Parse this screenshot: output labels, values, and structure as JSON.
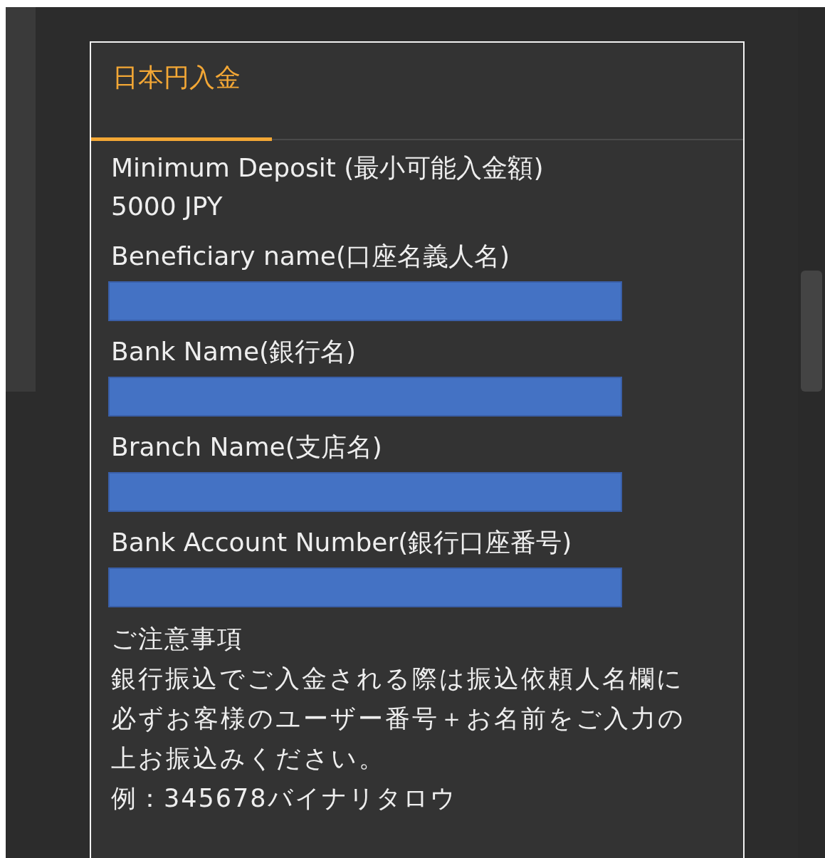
{
  "tabs": [
    {
      "label": "日本円入金",
      "selected": true
    }
  ],
  "fields": [
    {
      "kind": "text",
      "label": "Minimum Deposit (最小可能入金額)",
      "value": "5000 JPY"
    },
    {
      "kind": "redacted",
      "label": "Beneficiary name(口座名義人名)"
    },
    {
      "kind": "redacted",
      "label": "Bank Name(銀行名)"
    },
    {
      "kind": "redacted",
      "label": "Branch Name(支店名)"
    },
    {
      "kind": "redacted",
      "label": "Bank Account Number(銀行口座番号)"
    }
  ],
  "notice": {
    "title": "ご注意事項",
    "text": "銀行振込でご入金される際は振込依頼人名欄に必ずお客様のユーザー番号＋お名前をご入力の上お振込みください。",
    "example": "例：345678バイナリタロウ"
  }
}
